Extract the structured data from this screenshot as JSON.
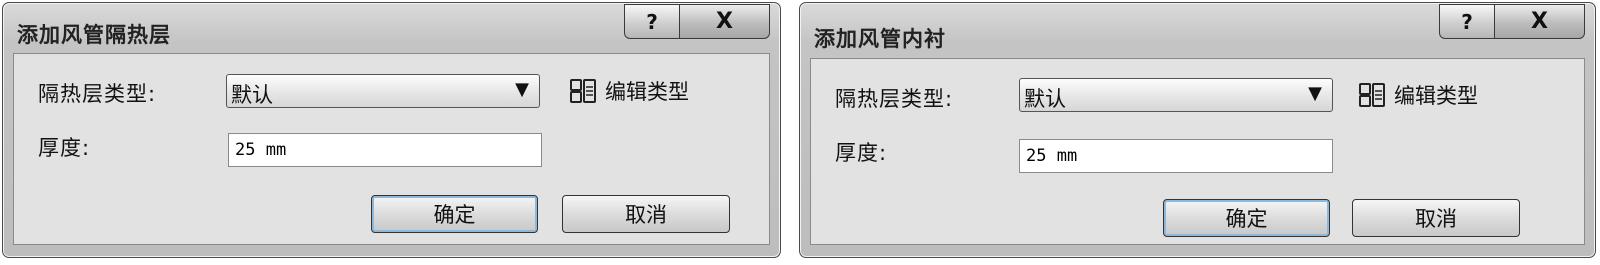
{
  "dialogs": [
    {
      "title": "添加风管隔热层",
      "help_label": "?",
      "close_label": "X",
      "type_label": "隔热层类型:",
      "type_value": "默认",
      "edit_type_label": "编辑类型",
      "thickness_label": "厚度:",
      "thickness_value": "25 mm",
      "ok_label": "确定",
      "cancel_label": "取消"
    },
    {
      "title": "添加风管内衬",
      "help_label": "?",
      "close_label": "X",
      "type_label": "隔热层类型:",
      "type_value": "默认",
      "edit_type_label": "编辑类型",
      "thickness_label": "厚度:",
      "thickness_value": "25 mm",
      "ok_label": "确定",
      "cancel_label": "取消"
    }
  ]
}
